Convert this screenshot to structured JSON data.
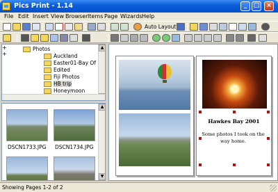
{
  "window": {
    "title": "Pics Print - 1.14"
  },
  "menu": [
    "File",
    "Edit",
    "Insert",
    "View",
    "Browser",
    "Items",
    "Page",
    "Wizards",
    "Help"
  ],
  "toolbar": {
    "auto_layout_label": "Auto Layout"
  },
  "tree": {
    "items": [
      {
        "label": "Photos",
        "expanded": true
      },
      {
        "label": "Auckland"
      },
      {
        "label": "Easter01-Bay Of Islan"
      },
      {
        "label": "Edited",
        "expandable": true
      },
      {
        "label": "Fiji Photos",
        "expandable": true
      },
      {
        "label": "HB trip",
        "selected": true
      },
      {
        "label": "Honeymoon"
      }
    ]
  },
  "thumbnails": [
    {
      "label": "DSCN1733.JPG"
    },
    {
      "label": "DSCN1734.JPG"
    },
    {
      "label": ""
    },
    {
      "label": ""
    }
  ],
  "page2": {
    "caption_title": "Hawkes Bay 2001",
    "caption_text": "Some photos I took on the way home."
  },
  "status": {
    "text": "Showing Pages 1-2 of 2"
  },
  "colors": {
    "title_blue": "#0451cd",
    "selection_handle": "#b01010"
  }
}
